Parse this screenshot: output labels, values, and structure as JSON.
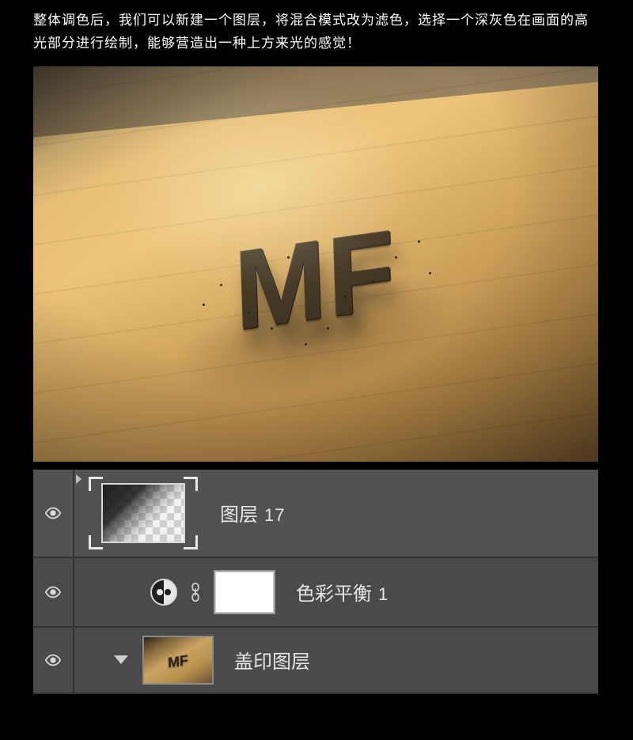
{
  "description": "整体调色后，我们可以新建一个图层，将混合模式改为滤色，选择一个深灰色在画面的高光部分进行绘制，能够营造出一种上方来光的感觉！",
  "artwork": {
    "text": "MF"
  },
  "layers_panel": {
    "rows": [
      {
        "name_prefix": "图层",
        "name_suffix": "17"
      },
      {
        "name_prefix": "色彩平衡",
        "name_suffix": "1"
      },
      {
        "name": "盖印图层"
      }
    ]
  }
}
